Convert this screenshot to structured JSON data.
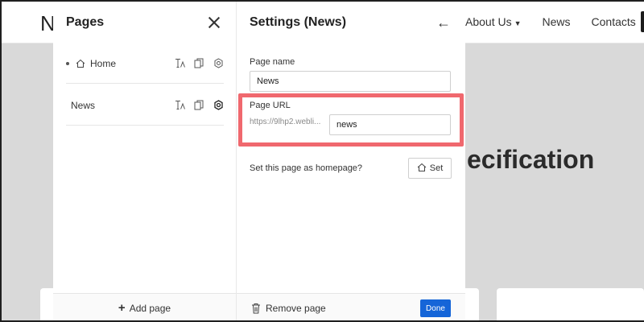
{
  "site": {
    "logo_letter": "N",
    "nav": [
      "About Us",
      "News",
      "Contacts"
    ],
    "hero_text": "ecification"
  },
  "pages_panel": {
    "title": "Pages",
    "items": [
      {
        "label": "Home",
        "is_home": true
      },
      {
        "label": "News",
        "is_home": false
      }
    ],
    "add_page_label": "Add page"
  },
  "settings_panel": {
    "title": "Settings (News)",
    "page_name_label": "Page name",
    "page_name_value": "News",
    "page_url_label": "Page URL",
    "url_prefix": "https://9lhp2.webli...",
    "url_slug_value": "news",
    "homepage_question": "Set this page as homepage?",
    "set_label": "Set",
    "remove_page_label": "Remove page",
    "done_label": "Done"
  },
  "colors": {
    "highlight": "#f0686e",
    "done_button": "#1565d8"
  }
}
